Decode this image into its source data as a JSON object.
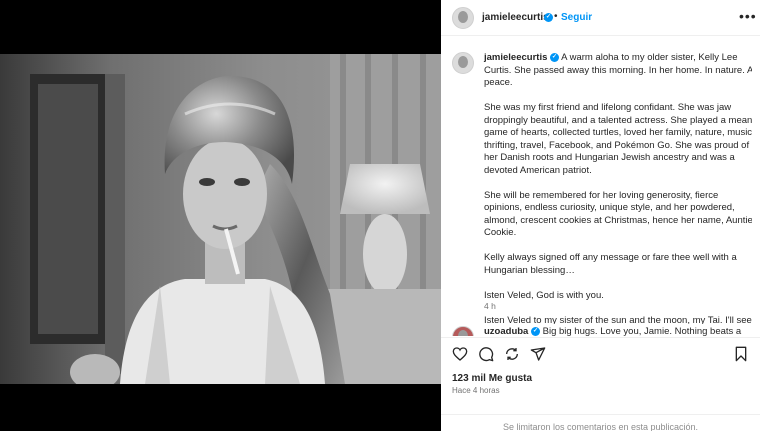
{
  "post": {
    "username": "jamieleecurtis",
    "follow_label": "Seguir",
    "separator": "•",
    "more_label": "•••",
    "caption_paragraphs": [
      "A warm aloha to my older sister, Kelly Lee Curtis. She passed away this morning. In her home. In nature. At peace.",
      "She was my first friend and lifelong confidant. She was jaw droppingly beautiful, and a talented actress. She played a mean game of hearts, collected turtles, loved her family, nature, music, thrifting, travel, Facebook, and Pokémon Go. She was proud of her Danish roots and Hungarian Jewish ancestry and was a devoted American patriot.",
      "She will be remembered for her loving generosity, fierce opinions, endless curiosity, unique style, and her powdered, almond, crescent cookies at Christmas, hence her name, Auntie Cookie.",
      "Kelly always signed off any message or fare thee well with a Hungarian blessing…",
      "Isten Veled, God is with you.",
      "Isten Veled to my sister of the sun and the moon, my Tai. I'll see you on down the line."
    ],
    "caption_time": "4 h",
    "likes": "123 mil Me gusta",
    "posted_ago": "Hace 4 horas",
    "comments_disabled": "Se limitaron los comentarios en esta publicación."
  },
  "comment": {
    "username": "uzoaduba",
    "text": "Big big hugs. Love you, Jamie. Nothing beats a"
  },
  "icons": [
    "heart-icon",
    "comment-icon",
    "share-icon",
    "send-icon",
    "bookmark-icon",
    "verified-icon",
    "more-icon"
  ],
  "colors": {
    "accent": "#0095f6",
    "muted": "#737373",
    "text": "#262626"
  }
}
